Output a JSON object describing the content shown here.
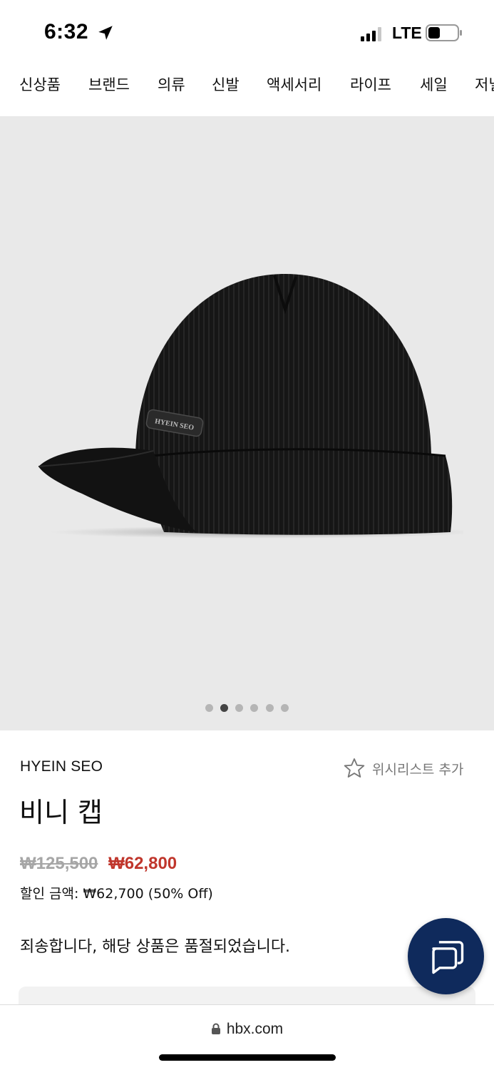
{
  "status_bar": {
    "time": "6:32",
    "network": "LTE",
    "icons": [
      "location-arrow-icon",
      "signal-icon",
      "battery-icon"
    ]
  },
  "categories": [
    "신상품",
    "브랜드",
    "의류",
    "신발",
    "액세서리",
    "라이프",
    "세일",
    "저널"
  ],
  "gallery": {
    "image": "black-knit-beanie-cap",
    "badge_text": "HYEIN SEO",
    "slide_count": 6,
    "active_slide": 2
  },
  "product": {
    "brand": "HYEIN SEO",
    "wishlist_label": "위시리스트 추가",
    "title": "비니 캡",
    "original_price": "₩125,500",
    "sale_price": "₩62,800",
    "discount_text": "할인 금액: ₩62,700 (50% Off)",
    "soldout_message": "죄송합니다, 해당 상품은 품절되었습니다."
  },
  "chat": {
    "icon": "chat-bubbles-icon"
  },
  "browser": {
    "url": "hbx.com",
    "icon": "lock-icon"
  },
  "colors": {
    "sale_red": "#c0362c",
    "chat_navy": "#0f2a5c",
    "image_bg": "#e9e9e9"
  }
}
